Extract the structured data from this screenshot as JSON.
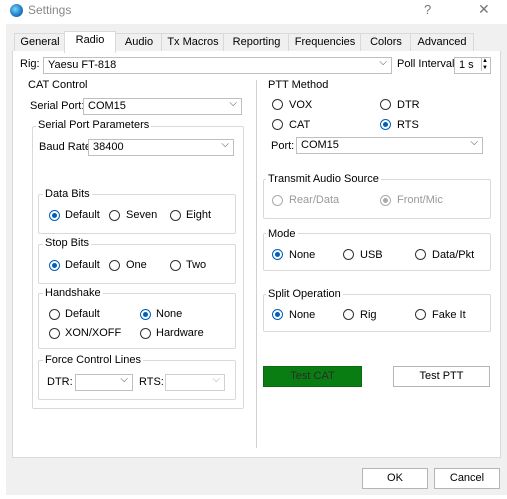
{
  "window": {
    "title": "Settings",
    "help_label": "?",
    "close_label": "✕"
  },
  "tabs": [
    {
      "label": "General"
    },
    {
      "label": "Radio"
    },
    {
      "label": "Audio"
    },
    {
      "label": "Tx Macros"
    },
    {
      "label": "Reporting"
    },
    {
      "label": "Frequencies"
    },
    {
      "label": "Colors"
    },
    {
      "label": "Advanced"
    }
  ],
  "rig": {
    "label": "Rig:",
    "value": "Yaesu FT-818"
  },
  "poll": {
    "label": "Poll Interval:",
    "value": "1 s"
  },
  "cat": {
    "title": "CAT Control",
    "serial_port_label": "Serial Port:",
    "serial_port_value": "COM15",
    "params": {
      "title": "Serial Port Parameters",
      "baud_label": "Baud Rate:",
      "baud_value": "38400"
    },
    "data_bits": {
      "title": "Data Bits",
      "options": [
        "Default",
        "Seven",
        "Eight"
      ],
      "selected": "Default"
    },
    "stop_bits": {
      "title": "Stop Bits",
      "options": [
        "Default",
        "One",
        "Two"
      ],
      "selected": "Default"
    },
    "handshake": {
      "title": "Handshake",
      "options": [
        "Default",
        "None",
        "XON/XOFF",
        "Hardware"
      ],
      "selected": "None"
    },
    "force": {
      "title": "Force Control Lines",
      "dtr_label": "DTR:",
      "dtr_value": "",
      "rts_label": "RTS:",
      "rts_value": ""
    }
  },
  "ptt": {
    "title": "PTT Method",
    "options": [
      "VOX",
      "DTR",
      "CAT",
      "RTS"
    ],
    "selected": "RTS",
    "port_label": "Port:",
    "port_value": "COM15"
  },
  "tx_audio": {
    "title": "Transmit Audio Source",
    "options": [
      "Rear/Data",
      "Front/Mic"
    ],
    "selected": "Front/Mic"
  },
  "mode": {
    "title": "Mode",
    "options": [
      "None",
      "USB",
      "Data/Pkt"
    ],
    "selected": "None"
  },
  "split": {
    "title": "Split Operation",
    "options": [
      "None",
      "Rig",
      "Fake It"
    ],
    "selected": "None"
  },
  "buttons": {
    "test_cat": "Test CAT",
    "test_ptt": "Test PTT",
    "ok": "OK",
    "cancel": "Cancel"
  },
  "colors": {
    "accent": "#005fb8",
    "test_cat_bg": "#0a7d12"
  }
}
